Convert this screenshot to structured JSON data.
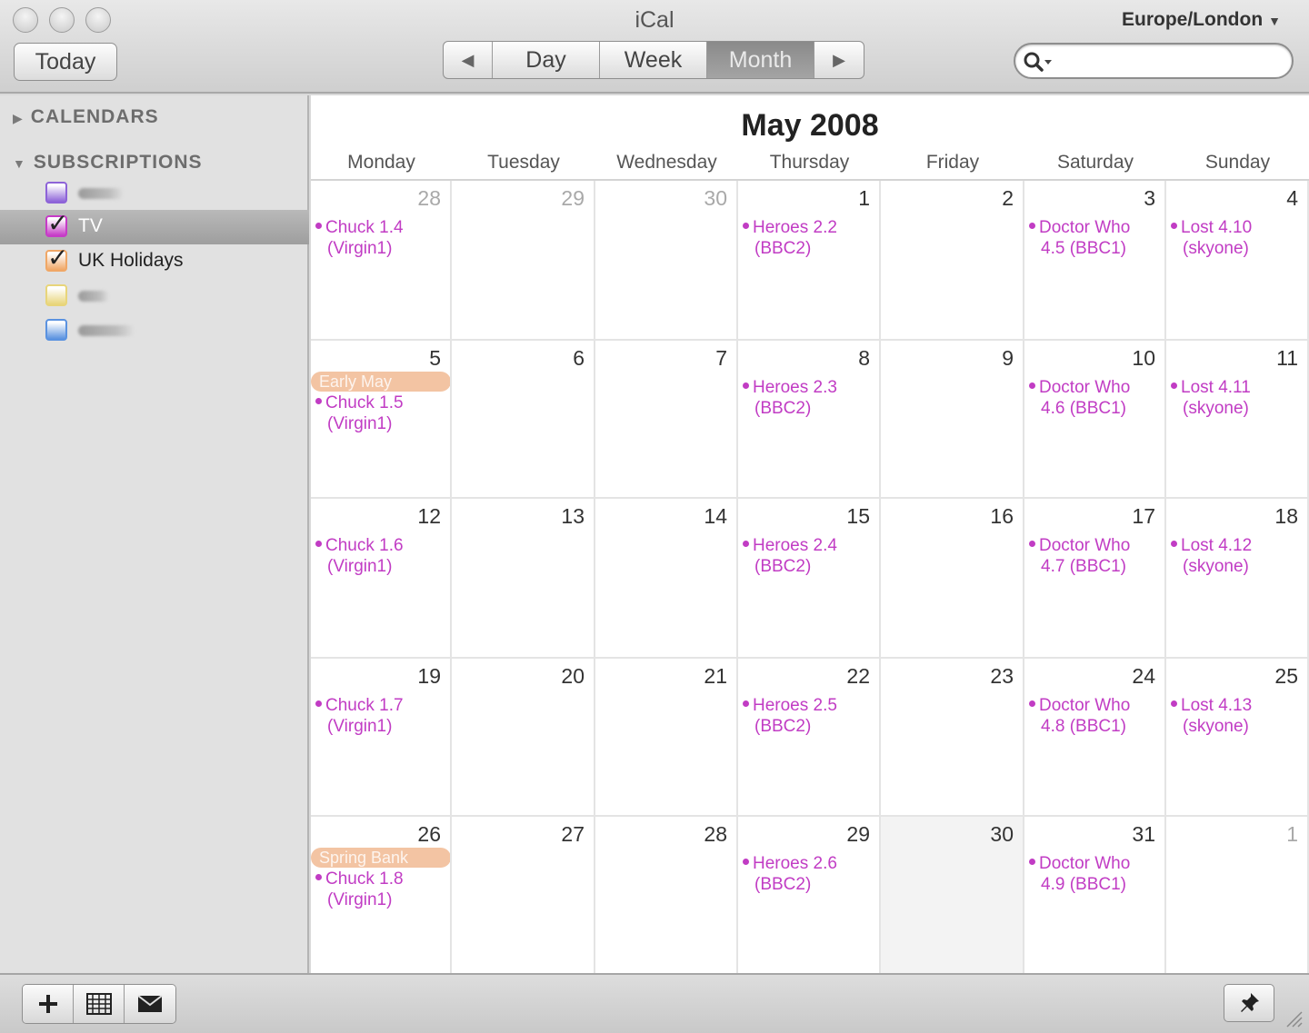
{
  "window": {
    "title": "iCal",
    "timezone": "Europe/London",
    "today_label": "Today",
    "views": [
      "Day",
      "Week",
      "Month"
    ],
    "active_view": "Month"
  },
  "sidebar": {
    "calendars_heading": "CALENDARS",
    "subscriptions_heading": "SUBSCRIPTIONS",
    "subscriptions": [
      {
        "label": "",
        "color": "#8d63d8",
        "checked": false,
        "selected": false
      },
      {
        "label": "TV",
        "color": "#c63bc7",
        "checked": true,
        "selected": true
      },
      {
        "label": "UK Holidays",
        "color": "#f0a766",
        "checked": true,
        "selected": false
      },
      {
        "label": "",
        "color": "#e8d57a",
        "checked": false,
        "selected": false
      },
      {
        "label": "",
        "color": "#5a92e0",
        "checked": false,
        "selected": false
      }
    ]
  },
  "calendar": {
    "month_title": "May 2008",
    "weekdays": [
      "Monday",
      "Tuesday",
      "Wednesday",
      "Thursday",
      "Friday",
      "Saturday",
      "Sunday"
    ],
    "event_color": "#c13cc4",
    "holiday_color": "#f3c4a3",
    "weeks": [
      [
        {
          "day": "28",
          "other": true,
          "events": [
            [
              "Chuck 1.4",
              "(Virgin1)"
            ]
          ]
        },
        {
          "day": "29",
          "other": true,
          "events": []
        },
        {
          "day": "30",
          "other": true,
          "events": []
        },
        {
          "day": "1",
          "events": [
            [
              "Heroes 2.2",
              "(BBC2)"
            ]
          ]
        },
        {
          "day": "2",
          "events": []
        },
        {
          "day": "3",
          "events": [
            [
              "Doctor Who",
              "4.5 (BBC1)"
            ]
          ]
        },
        {
          "day": "4",
          "events": [
            [
              "Lost 4.10",
              "(skyone)"
            ]
          ]
        }
      ],
      [
        {
          "day": "5",
          "holiday": "Early May",
          "events": [
            [
              "Chuck 1.5",
              "(Virgin1)"
            ]
          ]
        },
        {
          "day": "6",
          "events": []
        },
        {
          "day": "7",
          "events": []
        },
        {
          "day": "8",
          "events": [
            [
              "Heroes 2.3",
              "(BBC2)"
            ]
          ]
        },
        {
          "day": "9",
          "events": []
        },
        {
          "day": "10",
          "events": [
            [
              "Doctor Who",
              "4.6 (BBC1)"
            ]
          ]
        },
        {
          "day": "11",
          "events": [
            [
              "Lost 4.11",
              "(skyone)"
            ]
          ]
        }
      ],
      [
        {
          "day": "12",
          "events": [
            [
              "Chuck 1.6",
              "(Virgin1)"
            ]
          ]
        },
        {
          "day": "13",
          "events": []
        },
        {
          "day": "14",
          "events": []
        },
        {
          "day": "15",
          "events": [
            [
              "Heroes 2.4",
              "(BBC2)"
            ]
          ]
        },
        {
          "day": "16",
          "events": []
        },
        {
          "day": "17",
          "events": [
            [
              "Doctor Who",
              "4.7 (BBC1)"
            ]
          ]
        },
        {
          "day": "18",
          "events": [
            [
              "Lost 4.12",
              "(skyone)"
            ]
          ]
        }
      ],
      [
        {
          "day": "19",
          "events": [
            [
              "Chuck 1.7",
              "(Virgin1)"
            ]
          ]
        },
        {
          "day": "20",
          "events": []
        },
        {
          "day": "21",
          "events": []
        },
        {
          "day": "22",
          "events": [
            [
              "Heroes 2.5",
              "(BBC2)"
            ]
          ]
        },
        {
          "day": "23",
          "events": []
        },
        {
          "day": "24",
          "events": [
            [
              "Doctor Who",
              "4.8 (BBC1)"
            ]
          ]
        },
        {
          "day": "25",
          "events": [
            [
              "Lost 4.13",
              "(skyone)"
            ]
          ]
        }
      ],
      [
        {
          "day": "26",
          "holiday": "Spring Bank",
          "events": [
            [
              "Chuck 1.8",
              "(Virgin1)"
            ]
          ]
        },
        {
          "day": "27",
          "events": []
        },
        {
          "day": "28",
          "events": []
        },
        {
          "day": "29",
          "events": [
            [
              "Heroes 2.6",
              "(BBC2)"
            ]
          ]
        },
        {
          "day": "30",
          "shaded": true,
          "events": []
        },
        {
          "day": "31",
          "events": [
            [
              "Doctor Who",
              "4.9 (BBC1)"
            ]
          ]
        },
        {
          "day": "1",
          "other": true,
          "events": []
        }
      ]
    ]
  }
}
